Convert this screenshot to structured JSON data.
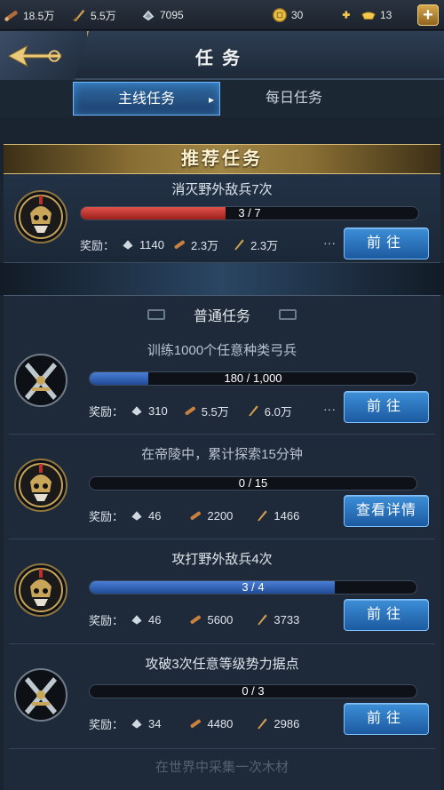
{
  "resources": {
    "wood": "18.5万",
    "weapon": "5.5万",
    "silver": "7095",
    "gold_coin": "30",
    "ingot": "13"
  },
  "header": {
    "title": "任务"
  },
  "tabs": [
    {
      "label": "主线任务",
      "active": true
    },
    {
      "label": "每日任务",
      "active": false
    }
  ],
  "recommend": {
    "banner": "推荐任务",
    "task": {
      "title": "消灭野外敌兵7次",
      "progress_text": "3 / 7",
      "progress": 0.43,
      "reward_label": "奖励：",
      "rewards": [
        "1140",
        "2.3万",
        "2.3万"
      ],
      "more": "···",
      "button": "前往"
    }
  },
  "normal": {
    "title": "普通任务",
    "tasks": [
      {
        "title": "训练1000个任意种类弓兵",
        "progress_text": "180 / 1,000",
        "progress": 0.18,
        "rewards": [
          "310",
          "5.5万",
          "6.0万"
        ],
        "more": "···",
        "button": "前往"
      },
      {
        "title": "在帝陵中，累计探索15分钟",
        "progress_text": "0 / 15",
        "progress": 0.0,
        "rewards": [
          "46",
          "2200",
          "1466"
        ],
        "more": "",
        "button": "查看详情"
      },
      {
        "title": "攻打野外敌兵4次",
        "progress_text": "3 / 4",
        "progress": 0.75,
        "rewards": [
          "46",
          "5600",
          "3733"
        ],
        "more": "",
        "button": "前往"
      },
      {
        "title": "攻破3次任意等级势力据点",
        "progress_text": "0 / 3",
        "progress": 0.0,
        "rewards": [
          "34",
          "4480",
          "2986"
        ],
        "more": "",
        "button": "前往"
      }
    ],
    "reward_label": "奖励：",
    "partial_next": "在世界中采集一次木材"
  },
  "colors": {
    "accent_blue": "#2c6bb0",
    "progress_red": "#c9302c",
    "progress_blue": "#2a5aa8",
    "gold": "#d8be7a"
  }
}
